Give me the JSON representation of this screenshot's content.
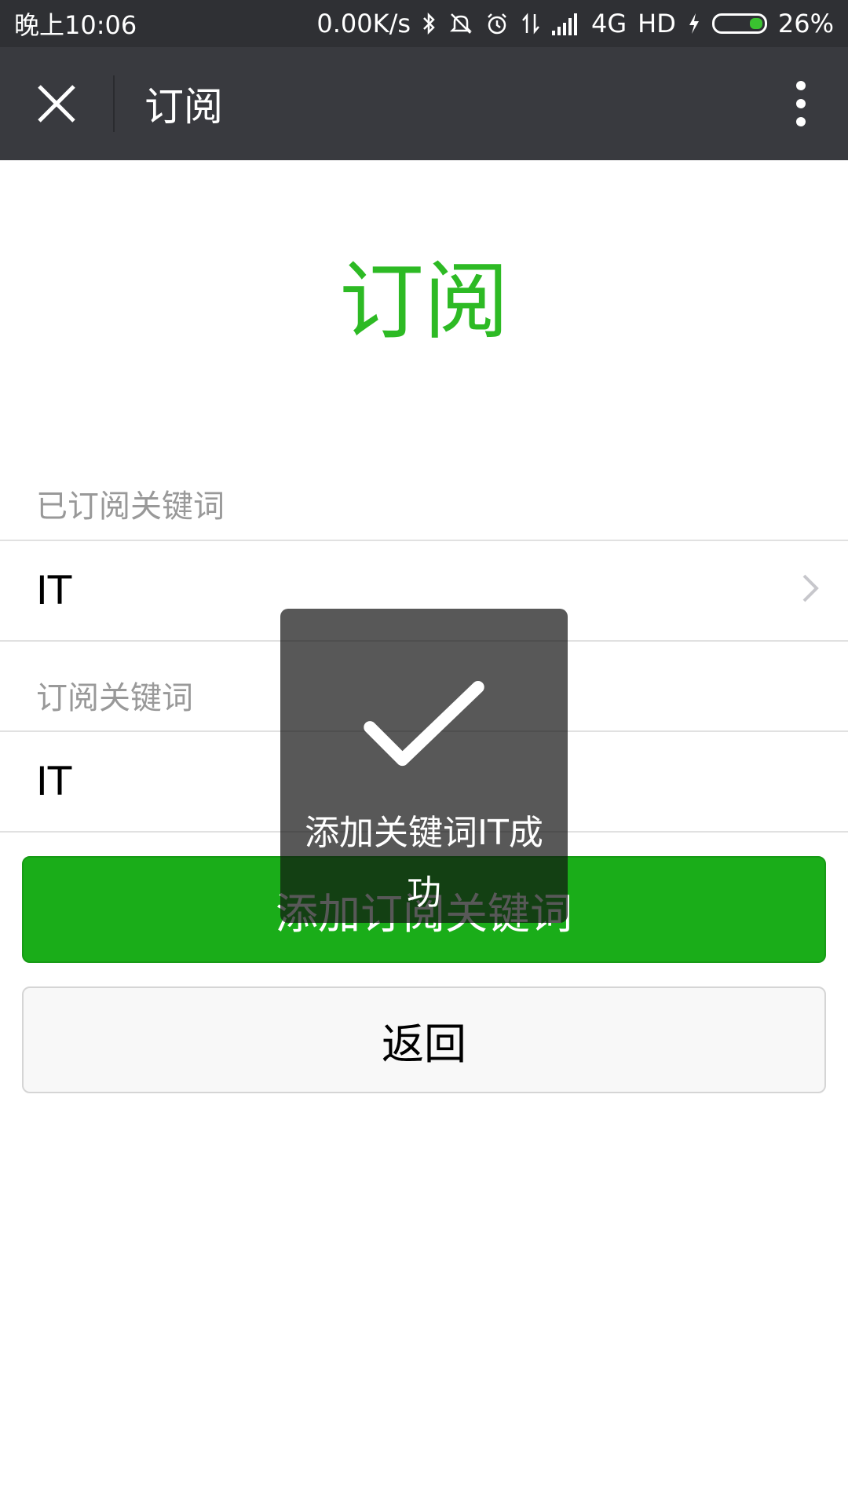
{
  "status_bar": {
    "time": "晚上10:06",
    "speed": "0.00K/s",
    "network": "4G",
    "hd": "HD",
    "battery": "26%"
  },
  "title_bar": {
    "title": "订阅",
    "close_icon": "close-icon",
    "more_icon": "more-vertical-icon"
  },
  "hero": {
    "title": "订阅"
  },
  "subscribed": {
    "label": "已订阅关键词",
    "items": [
      {
        "text": "IT"
      }
    ]
  },
  "subscribe": {
    "label": "订阅关键词",
    "input_value": "IT"
  },
  "buttons": {
    "add_label": "添加订阅关键词",
    "back_label": "返回"
  },
  "toast": {
    "icon": "checkmark-icon",
    "text": "添加关键词IT成功"
  },
  "colors": {
    "accent": "#1aad19",
    "title_bar": "#393a3f",
    "hero_green": "#2dba24"
  }
}
